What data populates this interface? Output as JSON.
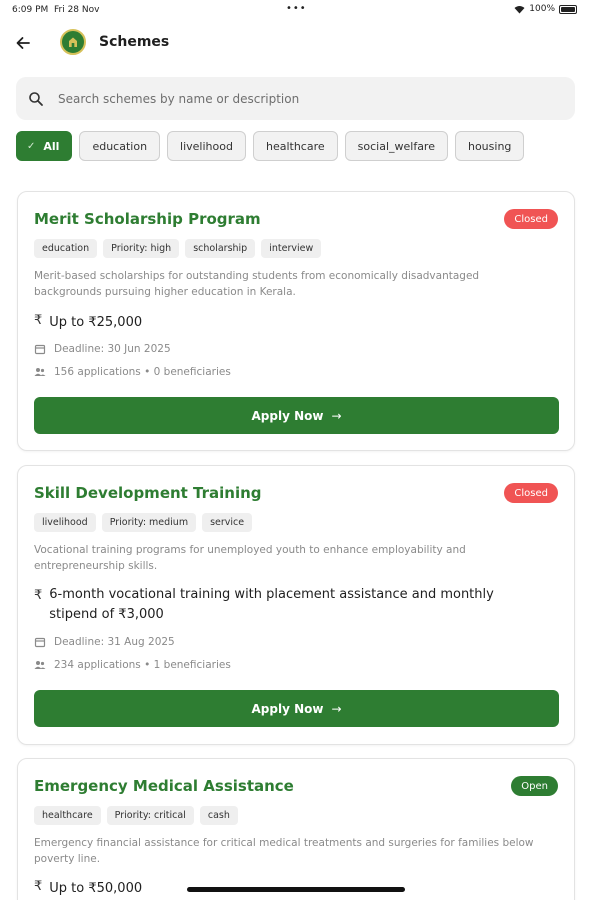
{
  "status_bar": {
    "time": "6:09 PM",
    "date": "Fri 28 Nov",
    "dots": "•••",
    "battery": "100%"
  },
  "header": {
    "title": "Schemes"
  },
  "search": {
    "placeholder": "Search schemes by name or description"
  },
  "filters": [
    {
      "label": "All",
      "active": true
    },
    {
      "label": "education",
      "active": false
    },
    {
      "label": "livelihood",
      "active": false
    },
    {
      "label": "healthcare",
      "active": false
    },
    {
      "label": "social_welfare",
      "active": false
    },
    {
      "label": "housing",
      "active": false
    }
  ],
  "schemes": [
    {
      "title": "Merit Scholarship Program",
      "status": "Closed",
      "tags": [
        "education",
        "Priority: high",
        "scholarship",
        "interview"
      ],
      "description": "Merit-based scholarships for outstanding students from economically disadvantaged backgrounds pursuing higher education in Kerala.",
      "benefit": "Up to ₹25,000",
      "deadline": "Deadline: 30 Jun 2025",
      "stats": "156 applications • 0 beneficiaries",
      "apply_label": "Apply Now",
      "rupee": "₹"
    },
    {
      "title": "Skill Development Training",
      "status": "Closed",
      "tags": [
        "livelihood",
        "Priority: medium",
        "service"
      ],
      "description": "Vocational training programs for unemployed youth to enhance employability and entrepreneurship skills.",
      "benefit": "6-month vocational training with placement assistance and monthly stipend of ₹3,000",
      "deadline": "Deadline: 31 Aug 2025",
      "stats": "234 applications • 1 beneficiaries",
      "apply_label": "Apply Now",
      "rupee": "₹"
    },
    {
      "title": "Emergency Medical Assistance",
      "status": "Open",
      "tags": [
        "healthcare",
        "Priority: critical",
        "cash"
      ],
      "description": "Emergency financial assistance for critical medical treatments and surgeries for families below poverty line.",
      "benefit": "Up to ₹50,000",
      "rupee": "₹"
    }
  ],
  "colors": {
    "primary": "#2e7d32",
    "closed": "#f05454",
    "chip_bg": "#f2f2f2"
  },
  "icons": [
    "back-arrow-icon",
    "logo-icon",
    "search-icon",
    "check-icon",
    "calendar-icon",
    "people-icon",
    "arrow-right-icon",
    "wifi-icon",
    "battery-icon"
  ]
}
